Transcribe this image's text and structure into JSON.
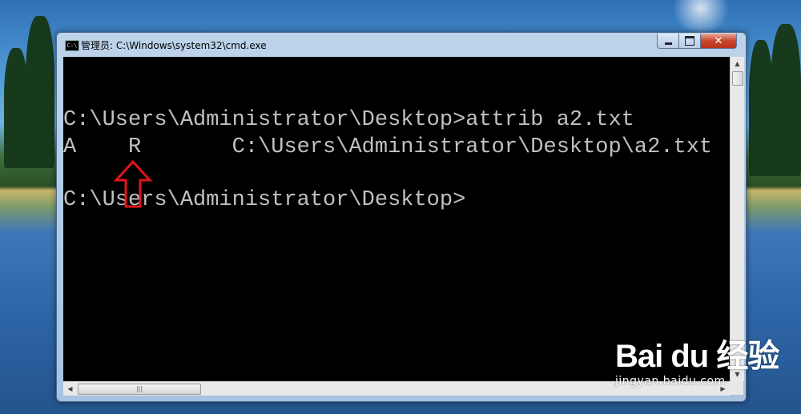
{
  "window": {
    "title": "管理员: C:\\Windows\\system32\\cmd.exe",
    "icon_label": "C:\\"
  },
  "controls": {
    "minimize": "minimize-icon",
    "maximize": "maximize-icon",
    "close": "✕"
  },
  "console": {
    "lines": [
      "C:\\Users\\Administrator\\Desktop>attrib a2.txt",
      "A    R       C:\\Users\\Administrator\\Desktop\\a2.txt",
      "",
      "C:\\Users\\Administrator\\Desktop>"
    ]
  },
  "scrollbar": {
    "up_arrow": "▲",
    "down_arrow": "▼",
    "left_arrow": "◀",
    "right_arrow": "▶",
    "h_thumb_grip": "|||"
  },
  "annotation": {
    "color": "#e0151c",
    "icon": "up-arrow-icon"
  },
  "watermark": {
    "logo": "Bai du 经验",
    "url": "jingyan.baidu.com"
  }
}
